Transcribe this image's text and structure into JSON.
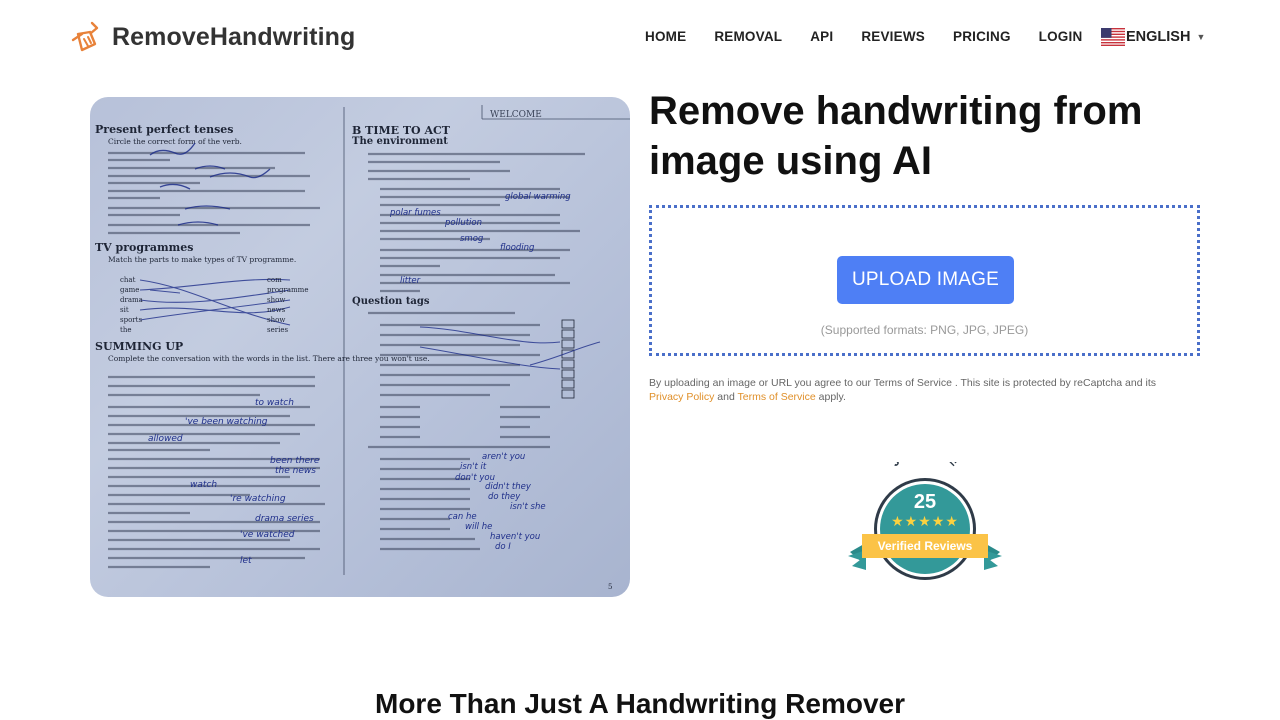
{
  "header": {
    "brand": "RemoveHandwriting",
    "logo_icon": "broom-icon",
    "nav": [
      {
        "label": "HOME"
      },
      {
        "label": "REMOVAL"
      },
      {
        "label": "API"
      },
      {
        "label": "REVIEWS"
      },
      {
        "label": "PRICING"
      },
      {
        "label": "LOGIN"
      }
    ],
    "language": {
      "label": "ENGLISH",
      "flag_icon": "us-flag-icon",
      "caret": "▼"
    }
  },
  "hero": {
    "image_alt": "Worksheet page with handwriting",
    "title": "Remove handwriting from image using AI",
    "upload_button": "UPLOAD IMAGE",
    "supported_formats": "(Supported formats: PNG, JPG, JPEG)",
    "terms": {
      "prefix": "By uploading an image or URL you agree to our Terms of Service . This site is protected by reCaptcha and its ",
      "privacy_link": "Privacy Policy",
      "and": " and ",
      "terms_link": "Terms of Service",
      "suffix": " apply."
    }
  },
  "badge": {
    "brand": "JUDGE.ME",
    "count": "25",
    "stars": "★★★★★",
    "label": "Verified Reviews"
  },
  "worksheet": {
    "welcome": "WELCOME",
    "left_heading": "Present perfect tenses",
    "left_item": "Circle the correct form of the verb.",
    "tv_heading": "TV programmes",
    "tv_item": "Match the parts to make types of TV programme.",
    "summing_heading": "SUMMING UP",
    "summing_item": "Complete the conversation with the words in the list. There are three you won't use.",
    "right_heading": "B  TIME TO ACT",
    "right_sub": "The environment",
    "question_tags": "Question tags",
    "page_number": "5"
  },
  "section": {
    "title": "More Than Just A Handwriting Remover"
  }
}
